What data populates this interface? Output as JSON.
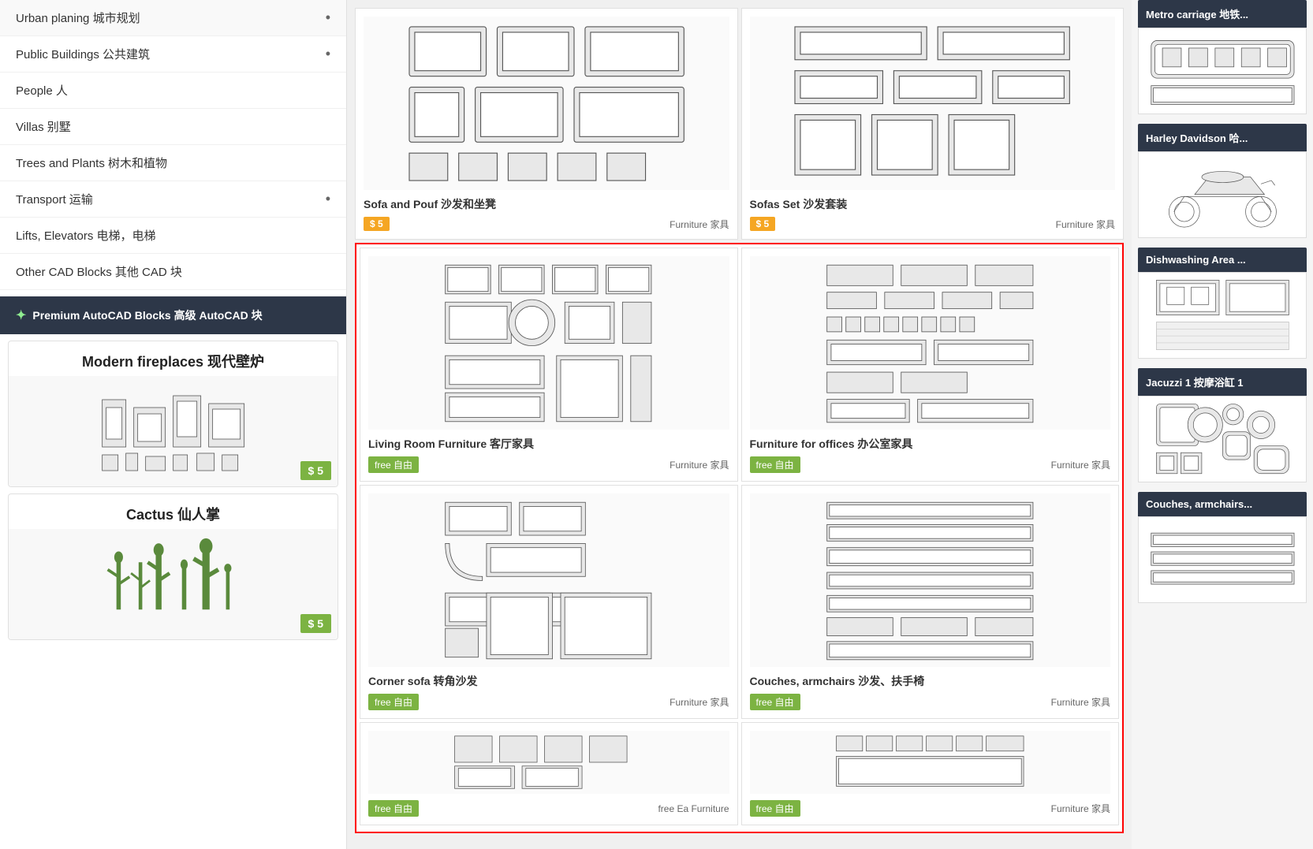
{
  "sidebar": {
    "nav_items": [
      {
        "label": "Urban planing 城市规划",
        "has_dot": true
      },
      {
        "label": "Public Buildings 公共建筑",
        "has_dot": true
      },
      {
        "label": "People 人",
        "has_dot": false
      },
      {
        "label": "Villas 别墅",
        "has_dot": false
      },
      {
        "label": "Trees and Plants 树木和植物",
        "has_dot": false
      },
      {
        "label": "Transport 运输",
        "has_dot": true
      },
      {
        "label": "Lifts, Elevators 电梯，电梯",
        "has_dot": false
      },
      {
        "label": "Other CAD Blocks 其他 CAD 块",
        "has_dot": false
      }
    ],
    "premium_label": "Premium AutoCAD Blocks 高级 AutoCAD 块",
    "promo_cards": [
      {
        "title": "Modern fireplaces 现代壁炉",
        "price": "$ 5"
      },
      {
        "title": "Cactus 仙人掌",
        "price": "$ 5"
      }
    ]
  },
  "top_products": [
    {
      "title": "Sofa and Pouf 沙发和坐凳",
      "price_tag": "$ 5",
      "category": "Furniture 家具"
    },
    {
      "title": "Sofas Set 沙发套装",
      "price_tag": "$ 5",
      "category": "Furniture 家具"
    }
  ],
  "main_products": [
    {
      "title": "Living Room Furniture 客厅家具",
      "tag": "free",
      "tag_label": "free 自由",
      "category": "Furniture 家具"
    },
    {
      "title": "Furniture for offices 办公室家具",
      "tag": "free",
      "tag_label": "free 自由",
      "category": "Furniture 家具"
    },
    {
      "title": "Corner sofa 转角沙发",
      "tag": "free",
      "tag_label": "free 自由",
      "category": "Furniture 家具"
    },
    {
      "title": "Couches, armchairs 沙发、扶手椅",
      "tag": "free",
      "tag_label": "free 自由",
      "category": "Furniture 家具"
    }
  ],
  "bottom_products": [
    {
      "title": "free Ea Furniture",
      "tag": "free",
      "tag_label": "free 自由",
      "category": "Furniture 家具"
    }
  ],
  "right_sidebar": [
    {
      "title": "Metro carriage 地铁..."
    },
    {
      "title": "Harley Davidson 哈..."
    },
    {
      "title": "Dishwashing Area ..."
    },
    {
      "title": "Jacuzzi 1 按摩浴缸 1"
    },
    {
      "title": "Couches, armchairs..."
    }
  ]
}
